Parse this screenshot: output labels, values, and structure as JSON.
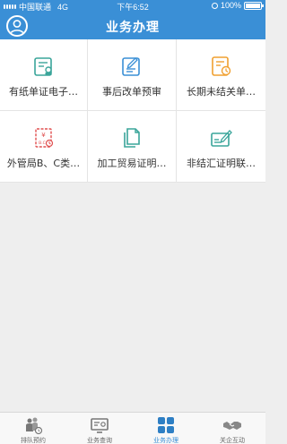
{
  "status_bar": {
    "carrier": "中国联通",
    "network": "4G",
    "time": "下午6:52",
    "battery": "100%"
  },
  "header": {
    "title": "业务办理",
    "avatar_icon": "user-avatar-icon"
  },
  "grid": {
    "items": [
      {
        "label": "有纸单证电子…",
        "icon": "paper-document-icon",
        "color": "#3aa59a"
      },
      {
        "label": "事后改单预审",
        "icon": "edit-form-icon",
        "color": "#3a8fd6"
      },
      {
        "label": "长期未结关单…",
        "icon": "clock-document-icon",
        "color": "#f0a030"
      },
      {
        "label": "外管局B、C类…",
        "icon": "currency-document-icon",
        "color": "#e05050"
      },
      {
        "label": "加工贸易证明…",
        "icon": "document-copy-icon",
        "color": "#3aa59a"
      },
      {
        "label": "非结汇证明联…",
        "icon": "sign-card-icon",
        "color": "#3aa59a"
      }
    ]
  },
  "tab_bar": {
    "tabs": [
      {
        "label": "排队预约",
        "icon": "queue-people-icon",
        "active": false
      },
      {
        "label": "业务查询",
        "icon": "query-monitor-icon",
        "active": false
      },
      {
        "label": "业务办理",
        "icon": "grid-apps-icon",
        "active": true
      },
      {
        "label": "关企互动",
        "icon": "handshake-icon",
        "active": false
      }
    ]
  },
  "colors": {
    "primary": "#3a8fd6",
    "background": "#eeeeee"
  }
}
